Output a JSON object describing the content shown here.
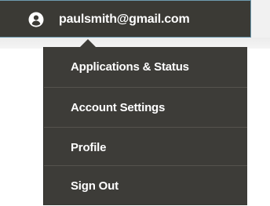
{
  "account": {
    "email": "paulsmith@gmail.com",
    "icon": "user-circle-icon"
  },
  "menu": {
    "items": [
      {
        "label": "Applications & Status"
      },
      {
        "label": "Account Settings"
      },
      {
        "label": "Profile"
      },
      {
        "label": "Sign Out"
      }
    ]
  },
  "colors": {
    "button_bg": "#3b3a35",
    "button_border": "#6f9bb0",
    "menu_bg": "#3d3c38",
    "divider": "#55534d",
    "text": "#ffffff",
    "page_band": "#f1f1f1"
  }
}
